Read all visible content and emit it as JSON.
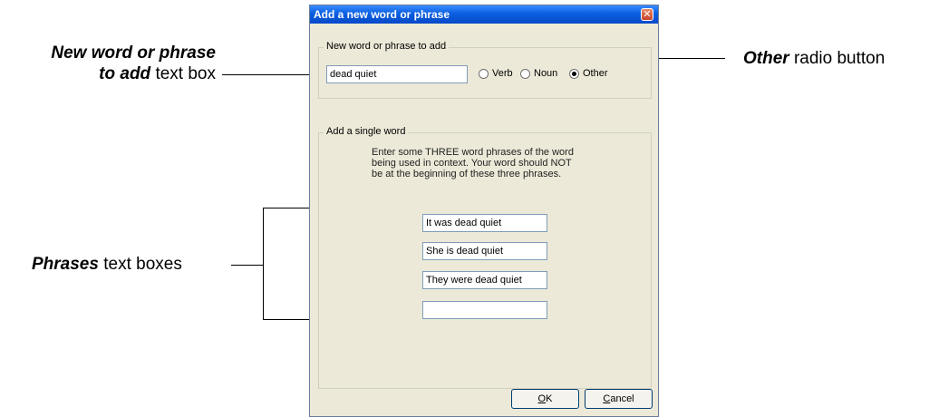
{
  "callouts": {
    "word_box_line1": "New word or phrase",
    "word_box_line2_bold": "to add",
    "word_box_line2_rest": " text box",
    "other_radio_bold": "Other",
    "other_radio_rest": " radio button",
    "phrases_bold": "Phrases",
    "phrases_rest": " text boxes"
  },
  "dialog": {
    "title": "Add a new word or phrase",
    "close_glyph": "✕",
    "new_word_group": {
      "legend": "New word or phrase to add",
      "input_value": "dead quiet",
      "radios": [
        {
          "label": "Verb",
          "checked": false
        },
        {
          "label": "Noun",
          "checked": false
        },
        {
          "label": "Other",
          "checked": true
        }
      ]
    },
    "single_word_group": {
      "legend": "Add a single word",
      "instructions": [
        "Enter some THREE word phrases of the word",
        "being used in context.  Your word should NOT",
        "be at the beginning of these three phrases."
      ],
      "phrases": [
        "It was dead quiet",
        "She is dead quiet",
        "They were dead quiet",
        ""
      ]
    },
    "buttons": {
      "ok_hotkey": "O",
      "ok_rest": "K",
      "cancel_hotkey": "C",
      "cancel_rest": "ancel"
    }
  }
}
